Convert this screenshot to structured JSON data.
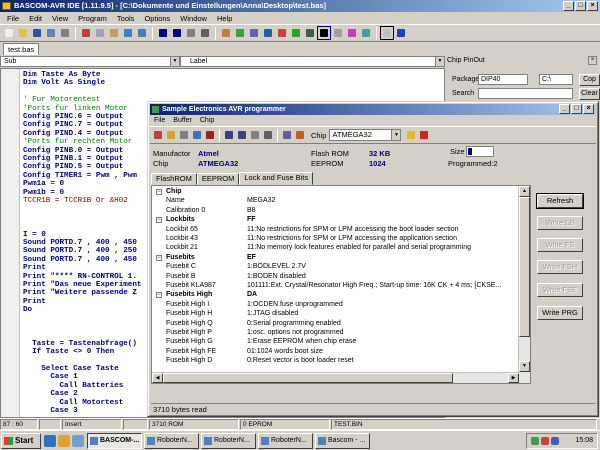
{
  "app": {
    "title": "BASCOM-AVR IDE [1.11.9.5] - [C:\\Dokumente und Einstellungen\\Anna\\Desktop\\test.bas]"
  },
  "menu": [
    "File",
    "Edit",
    "View",
    "Program",
    "Tools",
    "Options",
    "Window",
    "Help"
  ],
  "file_tab": "test.bas",
  "sub_bar": {
    "sub_label": "Sub",
    "label_label": "Label"
  },
  "code": [
    {
      "t": "Dim Taste As Byte",
      "c": "kw"
    },
    {
      "t": "Dim Volt As Single",
      "c": "kw"
    },
    {
      "t": "",
      "c": ""
    },
    {
      "t": "' Fur Motorentest",
      "c": "cm"
    },
    {
      "t": "'Ports fur linken Motor",
      "c": "cm"
    },
    {
      "t": "Config PINC.6 = Output",
      "c": "kw"
    },
    {
      "t": "Config PINC.7 = Output",
      "c": "kw"
    },
    {
      "t": "Config PIND.4 = Output",
      "c": "kw"
    },
    {
      "t": "'Ports fur rechten Motor",
      "c": "cm"
    },
    {
      "t": "Config PINB.0 = Output",
      "c": "kw"
    },
    {
      "t": "Config PINB.1 = Output",
      "c": "kw"
    },
    {
      "t": "Config PIND.5 = Output",
      "c": "kw"
    },
    {
      "t": "Config TIMER1 = Pwm , Pwm",
      "c": "kw"
    },
    {
      "t": "Pwm1a = 0",
      "c": "kw"
    },
    {
      "t": "Pwm1b = 0",
      "c": "kw"
    },
    {
      "t": "TCCR1B = TCCR1B Or &H02",
      "c": "rd"
    },
    {
      "t": "",
      "c": ""
    },
    {
      "t": "",
      "c": ""
    },
    {
      "t": "",
      "c": ""
    },
    {
      "t": "I = 0",
      "c": "kw"
    },
    {
      "t": "Sound PORTD.7 , 400 , 450",
      "c": "kw"
    },
    {
      "t": "Sound PORTD.7 , 400 , 250",
      "c": "kw"
    },
    {
      "t": "Sound PORTD.7 , 400 , 450",
      "c": "kw"
    },
    {
      "t": "Print",
      "c": "kw"
    },
    {
      "t": "Print \"**** RN-CONTROL 1.",
      "c": "kw"
    },
    {
      "t": "Print \"Das neue Experiment",
      "c": "kw"
    },
    {
      "t": "Print \"Weitere passende Z",
      "c": "kw"
    },
    {
      "t": "Print",
      "c": "kw"
    },
    {
      "t": "Do",
      "c": "kw"
    },
    {
      "t": "",
      "c": ""
    },
    {
      "t": "",
      "c": ""
    },
    {
      "t": "",
      "c": ""
    },
    {
      "t": "  Taste = Tastenabfrage()",
      "c": "kw"
    },
    {
      "t": "  If Taste <> 0 Then",
      "c": "kw"
    },
    {
      "t": "",
      "c": ""
    },
    {
      "t": "    Select Case Taste",
      "c": "kw"
    },
    {
      "t": "      Case 1",
      "c": "kw"
    },
    {
      "t": "        Call Batteries",
      "c": "kw"
    },
    {
      "t": "      Case 2",
      "c": "kw"
    },
    {
      "t": "        Call Motortest",
      "c": "kw"
    },
    {
      "t": "      Case 3",
      "c": "kw"
    }
  ],
  "chip_pinout": {
    "title": "Chip PinOut",
    "package_label": "Package",
    "package_value": "DIP40",
    "package_extra": "C:\\",
    "search_label": "Search",
    "copy_button": "Cop",
    "clear_button": "Clear"
  },
  "programmer": {
    "title": "Sample Electronics AVR programmer",
    "menu": [
      "File",
      "Buffer",
      "Chip"
    ],
    "chip_label": "Chip",
    "chip_value": "ATMEGA32",
    "manufactor_label": "Manufactor",
    "manufactor_value": "Atmel",
    "chip_info_label": "Chip",
    "chip_info_value": "ATMEGA32",
    "flash_label": "Flash ROM",
    "flash_value": "32 KB",
    "eeprom_label": "EEPROM",
    "eeprom_value": "1024",
    "size_label": "Size",
    "size_fill": 0.15,
    "programmed_label": "Programmed:2",
    "tabs": [
      "FlashROM",
      "EEPROM",
      "Lock and Fuse Bits"
    ],
    "rows": [
      {
        "type": "sec",
        "c1": "Chip",
        "c2": ""
      },
      {
        "type": "row",
        "c1": "Name",
        "c2": "MEGA32"
      },
      {
        "type": "row",
        "c1": "Calibration 0",
        "c2": "B8"
      },
      {
        "type": "sec",
        "c1": "Lockbits",
        "c2": "FF"
      },
      {
        "type": "row",
        "c1": "Lockbit 65",
        "c2": "11:No restrictions for SPM or LPM accessing the boot loader section"
      },
      {
        "type": "row",
        "c1": "Lockbit 43",
        "c2": "11:No restrictions for SPM or LPM accessing the application section"
      },
      {
        "type": "row",
        "c1": "Lockbit 21",
        "c2": "11:No memory lock features enabled for parallel and serial programming"
      },
      {
        "type": "sec",
        "c1": "Fusebits",
        "c2": "EF"
      },
      {
        "type": "row",
        "c1": "Fusebit C",
        "c2": "1:BODLEVEL 2.7V"
      },
      {
        "type": "row",
        "c1": "Fusebit B",
        "c2": "1:BODEN disabled"
      },
      {
        "type": "row",
        "c1": "Fusebit KLA987",
        "c2": "101111:Ext. Crystal/Resonator High Freq.; Start-up time: 16K CK + 4 ms; [CKSE..."
      },
      {
        "type": "sec",
        "c1": "Fusebits High",
        "c2": "DA"
      },
      {
        "type": "row",
        "c1": "Fusebit High I",
        "c2": "1:OCDEN fuse unprogrammed"
      },
      {
        "type": "row",
        "c1": "Fusebit High H",
        "c2": "1:JTAG disabled"
      },
      {
        "type": "row",
        "c1": "Fusebit High Q",
        "c2": "0:Serial programming enabled"
      },
      {
        "type": "row",
        "c1": "Fusebit High P",
        "c2": "1:osc. options not programmed"
      },
      {
        "type": "row",
        "c1": "Fusebit High G",
        "c2": "1:Erase EEPROM when chip erase"
      },
      {
        "type": "row",
        "c1": "Fusebit High FE",
        "c2": "01:1024 words boot size"
      },
      {
        "type": "row",
        "c1": "Fusebit High D",
        "c2": "0:Reset vector is boot loader reset"
      }
    ],
    "buttons": {
      "refresh": "Refresh",
      "write_lb": "Write LB",
      "write_fs": "Write FS",
      "write_fsh": "Write FSH",
      "write_fse": "Write FSE",
      "write_prg": "Write PRG"
    },
    "status": "3710 bytes read"
  },
  "statusbar": [
    "87 : 60",
    "",
    "Insert",
    "",
    "3710 ROM",
    "0 EPROM",
    "TEST.BIN"
  ],
  "taskbar": {
    "start": "Start",
    "tasks": [
      "BASCOM-...",
      "RoboterN...",
      "RoboterN...",
      "RoboterN...",
      "Bascom - ..."
    ],
    "time": "15:08"
  },
  "colors": {
    "title_start": "#0a246a",
    "title_end": "#a6caf0",
    "keyword": "#000080",
    "comment": "#008000"
  }
}
